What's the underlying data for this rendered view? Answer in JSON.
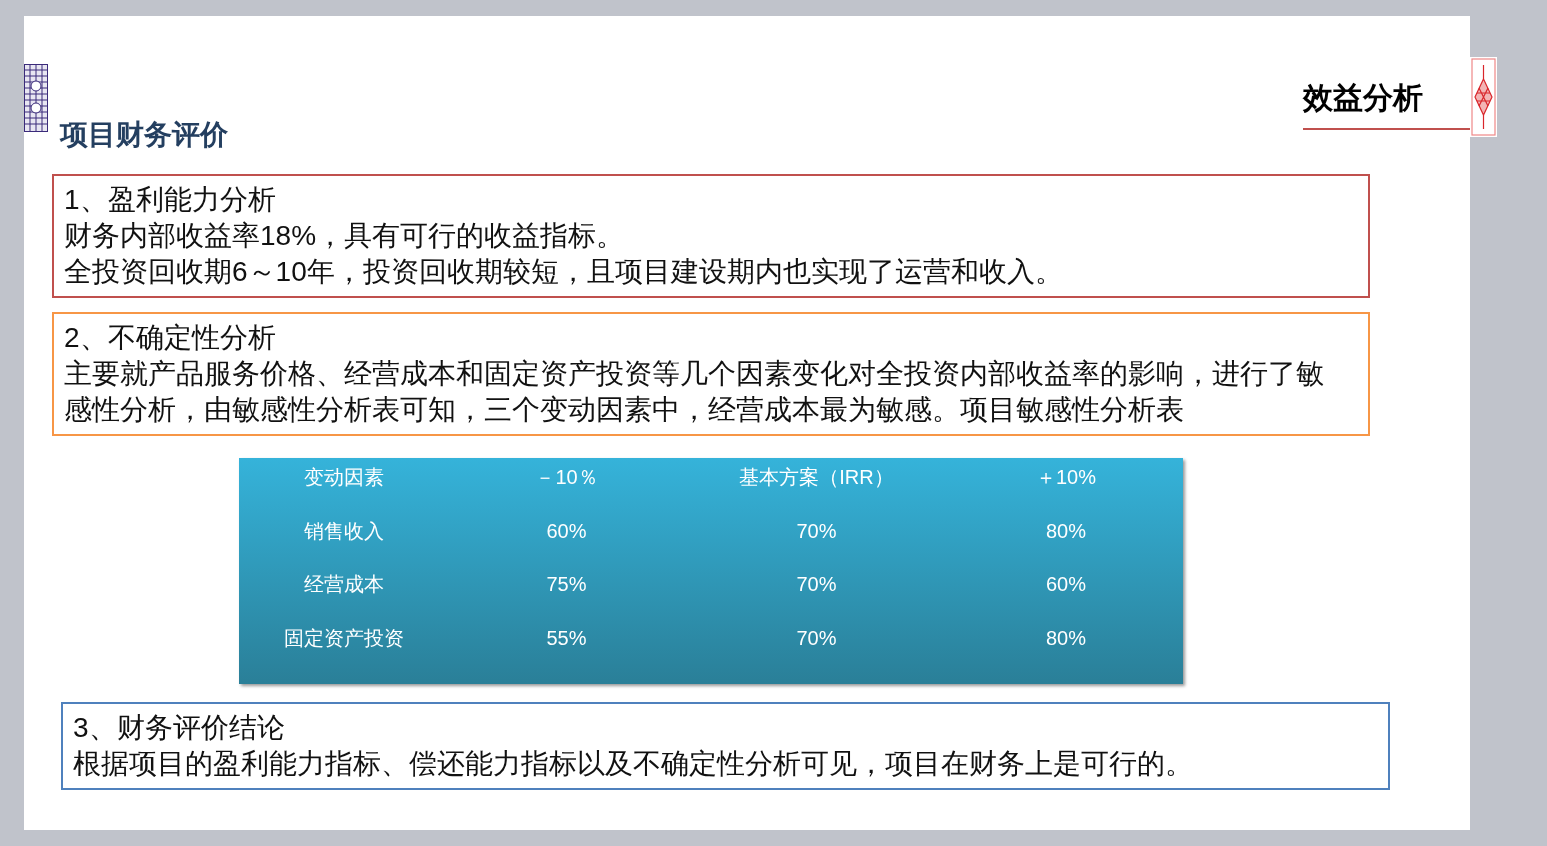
{
  "slide": {
    "title": "项目财务评价",
    "section_label": "效益分析",
    "blocks": [
      {
        "kind": "text",
        "color": "#c0504d",
        "heading": "1、盈利能力分析",
        "lines": [
          "财务内部收益率18%，具有可行的收益指标。",
          "全投资回收期6～10年，投资回收期较短，且项目建设期内也实现了运营和收入。"
        ]
      },
      {
        "kind": "text",
        "color": "#f79646",
        "heading": "2、不确定性分析",
        "lines": [
          "主要就产品服务价格、经营成本和固定资产投资等几个因素变化对全投资内部收益率的影响，进行了敏感性分析，由敏感性分析表可知，三个变动因素中，经营成本最为敏感。项目敏感性分析表"
        ]
      },
      {
        "kind": "table",
        "columns": [
          "变动因素",
          "－10％",
          "基本方案（IRR）",
          "＋10%"
        ],
        "rows": [
          [
            "销售收入",
            "60%",
            "70%",
            "80%"
          ],
          [
            "经营成本",
            "75%",
            "70%",
            "60%"
          ],
          [
            "固定资产投资",
            "55%",
            "70%",
            "80%"
          ]
        ]
      },
      {
        "kind": "text",
        "color": "#4f81bd",
        "heading": "3、财务评价结论",
        "lines": [
          "根据项目的盈利能力指标、偿还能力指标以及不确定性分析可见，项目在财务上是可行的。"
        ]
      }
    ]
  }
}
